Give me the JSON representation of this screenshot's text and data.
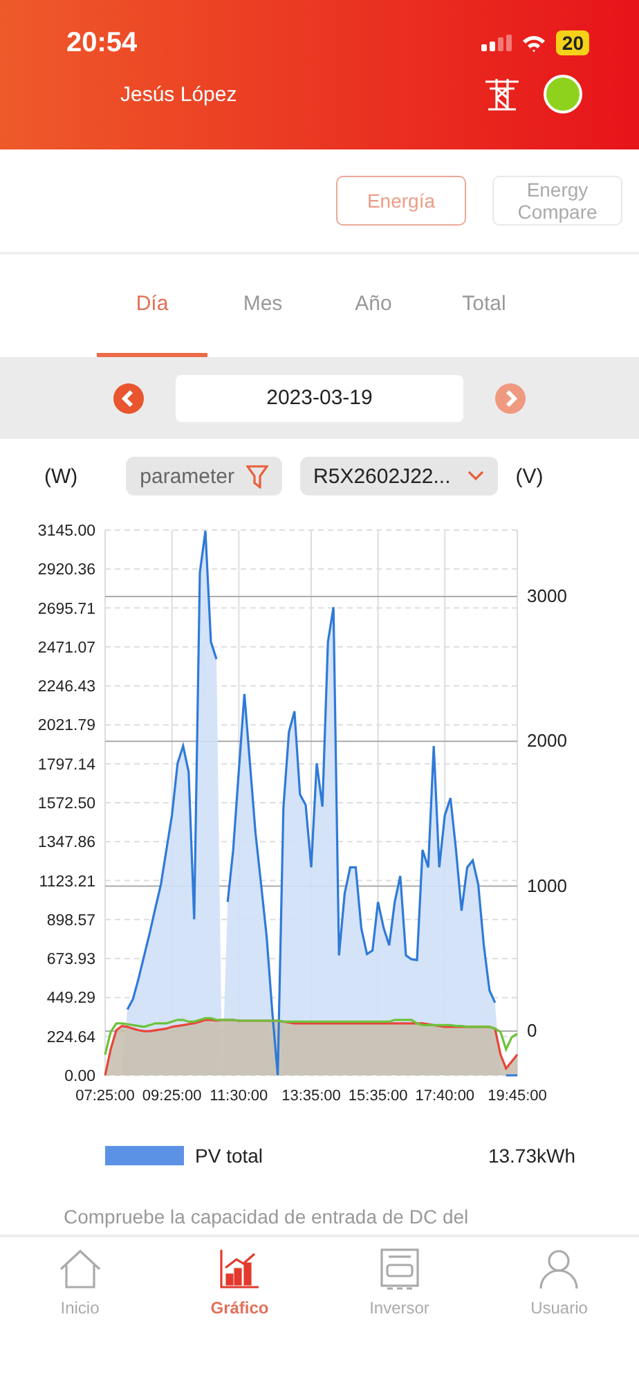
{
  "status_bar": {
    "time": "20:54",
    "battery": "20"
  },
  "header": {
    "user": "Jesús López",
    "online": true
  },
  "view_buttons": [
    {
      "label": "Energía",
      "selected": true
    },
    {
      "label": "Energy Compare",
      "selected": false
    }
  ],
  "tabs": [
    {
      "label": "Día",
      "selected": true
    },
    {
      "label": "Mes",
      "selected": false
    },
    {
      "label": "Año",
      "selected": false
    },
    {
      "label": "Total",
      "selected": false
    }
  ],
  "date_picker": {
    "value": "2023-03-19",
    "prev_disabled": false,
    "next_disabled": true
  },
  "filters": {
    "left_unit": "(W)",
    "parameter": "parameter",
    "device": "R5X2602J22...",
    "right_unit": "(V)"
  },
  "right_axis": {
    "ticks": [
      "3000",
      "2000",
      "1000",
      "0"
    ]
  },
  "chart": {
    "chart_data": {
      "type": "area",
      "categories": [
        "07:25:00",
        null,
        null,
        null,
        null,
        null,
        null,
        null,
        null,
        null,
        null,
        null,
        "09:25:00",
        null,
        null,
        null,
        null,
        null,
        null,
        null,
        null,
        null,
        null,
        null,
        "11:30:00",
        null,
        null,
        null,
        null,
        null,
        null,
        null,
        null,
        null,
        null,
        null,
        null,
        "13:35:00",
        null,
        null,
        null,
        null,
        null,
        null,
        null,
        null,
        null,
        null,
        null,
        "15:35:00",
        null,
        null,
        null,
        null,
        null,
        null,
        null,
        null,
        null,
        null,
        null,
        "17:40:00",
        null,
        null,
        null,
        null,
        null,
        null,
        null,
        null,
        null,
        null,
        null,
        null,
        "19:45:00"
      ],
      "ylim": [
        0,
        3145
      ],
      "grid": true,
      "yticks": [
        {
          "value": 0,
          "label": "0.00"
        },
        {
          "value": 224.64,
          "label": "224.64"
        },
        {
          "value": 449.29,
          "label": "449.29"
        },
        {
          "value": 673.93,
          "label": "673.93"
        },
        {
          "value": 898.57,
          "label": "898.57"
        },
        {
          "value": 1123.21,
          "label": "1123.21"
        },
        {
          "value": 1347.86,
          "label": "1347.86"
        },
        {
          "value": 1572.5,
          "label": "1572.50"
        },
        {
          "value": 1797.14,
          "label": "1797.14"
        },
        {
          "value": 2021.79,
          "label": "2021.79"
        },
        {
          "value": 2246.43,
          "label": "2246.43"
        },
        {
          "value": 2471.07,
          "label": "2471.07"
        },
        {
          "value": 2695.71,
          "label": "2695.71"
        },
        {
          "value": 2920.36,
          "label": "2920.36"
        },
        {
          "value": 3145,
          "label": "3145.00"
        }
      ],
      "series": [
        {
          "name": "PV total",
          "type": "area",
          "color": "#2f7ad8",
          "values": [
            0,
            null,
            null,
            null,
            380,
            440,
            559,
            690,
            820,
            960,
            1100,
            1300,
            1500,
            1800,
            1900,
            1750,
            900,
            2900,
            3140,
            2500,
            2400,
            null,
            1000,
            1300,
            1750,
            2200,
            1800,
            1400,
            1100,
            800,
            373,
            0,
            1543,
            1980,
            2100,
            1620,
            1560,
            1200,
            1800,
            1550,
            2500,
            2700,
            692,
            1050,
            1200,
            1200,
            850,
            700,
            720,
            1000,
            850,
            750,
            1000,
            1150,
            692,
            670,
            665,
            1300,
            1200,
            1900,
            1200,
            1500,
            1600,
            1300,
            950,
            1200,
            1240,
            1100,
            750,
            490,
            420,
            null,
            0,
            0,
            0
          ]
        },
        {
          "type": "area",
          "color": "#e8443a",
          "values": [
            0,
            150,
            260,
            285,
            280,
            270,
            260,
            255,
            255,
            260,
            265,
            270,
            280,
            285,
            290,
            295,
            300,
            310,
            320,
            320,
            315,
            320,
            320,
            320,
            315,
            315,
            315,
            315,
            315,
            315,
            315,
            315,
            310,
            305,
            300,
            300,
            300,
            300,
            300,
            300,
            300,
            300,
            300,
            300,
            300,
            300,
            300,
            300,
            300,
            300,
            300,
            300,
            300,
            300,
            300,
            300,
            300,
            300,
            295,
            290,
            285,
            280,
            280,
            280,
            280,
            280,
            280,
            280,
            280,
            280,
            270,
            120,
            40,
            80,
            120
          ]
        },
        {
          "type": "line",
          "color": "#6cc23a",
          "values": [
            120,
            250,
            300,
            300,
            295,
            290,
            285,
            280,
            290,
            300,
            300,
            300,
            310,
            320,
            320,
            310,
            310,
            320,
            330,
            330,
            320,
            320,
            320,
            320,
            315,
            315,
            315,
            315,
            315,
            315,
            315,
            315,
            310,
            310,
            310,
            310,
            310,
            310,
            310,
            310,
            310,
            310,
            310,
            310,
            310,
            310,
            310,
            310,
            310,
            310,
            310,
            310,
            320,
            320,
            320,
            320,
            300,
            290,
            290,
            290,
            290,
            290,
            290,
            285,
            285,
            280,
            280,
            280,
            280,
            280,
            270,
            250,
            150,
            220,
            240
          ]
        }
      ]
    }
  },
  "summary": {
    "color": "#5b92e5",
    "value": "13.73kWh"
  },
  "note": "Compruebe la capacidad de entrada de DC del",
  "nav": [
    {
      "label": "Inicio",
      "kind": "home",
      "selected": false
    },
    {
      "label": "Gráfico",
      "kind": "chart",
      "selected": true
    },
    {
      "label": "Inversor",
      "kind": "inverter",
      "selected": false
    },
    {
      "label": "Usuario",
      "kind": "user",
      "selected": false
    }
  ]
}
